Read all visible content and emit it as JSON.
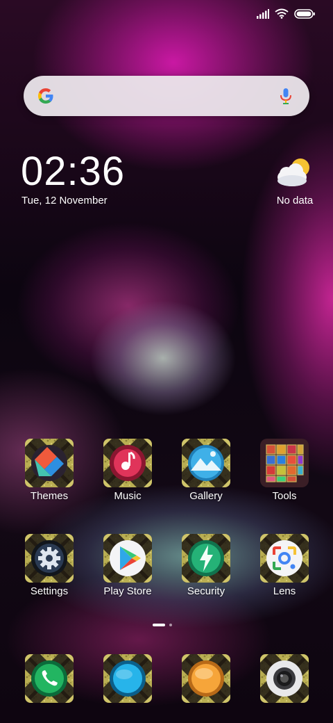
{
  "status_bar": {
    "icons": [
      "signal-icon",
      "wifi-icon",
      "battery-icon"
    ]
  },
  "search": {
    "icons": [
      "google-g-icon",
      "mic-icon"
    ]
  },
  "clock": {
    "time": "02:36",
    "date": "Tue, 12 November"
  },
  "weather": {
    "icon": "partly-cloudy-icon",
    "text": "No data"
  },
  "apps_row1": [
    {
      "label": "Themes",
      "icon": "themes-icon"
    },
    {
      "label": "Music",
      "icon": "music-icon"
    },
    {
      "label": "Gallery",
      "icon": "gallery-icon"
    },
    {
      "label": "Tools",
      "icon": "tools-folder-icon"
    }
  ],
  "apps_row2": [
    {
      "label": "Settings",
      "icon": "settings-icon"
    },
    {
      "label": "Play Store",
      "icon": "play-store-icon"
    },
    {
      "label": "Security",
      "icon": "security-icon"
    },
    {
      "label": "Lens",
      "icon": "lens-icon"
    }
  ],
  "page_indicator": {
    "pages": 2,
    "current": 1
  },
  "dock": [
    {
      "icon": "phone-icon"
    },
    {
      "icon": "messaging-icon"
    },
    {
      "icon": "browser-icon"
    },
    {
      "icon": "camera-icon"
    }
  ],
  "colors": {
    "frame": "#b8ad52",
    "frame_dark": "#2a2218"
  }
}
